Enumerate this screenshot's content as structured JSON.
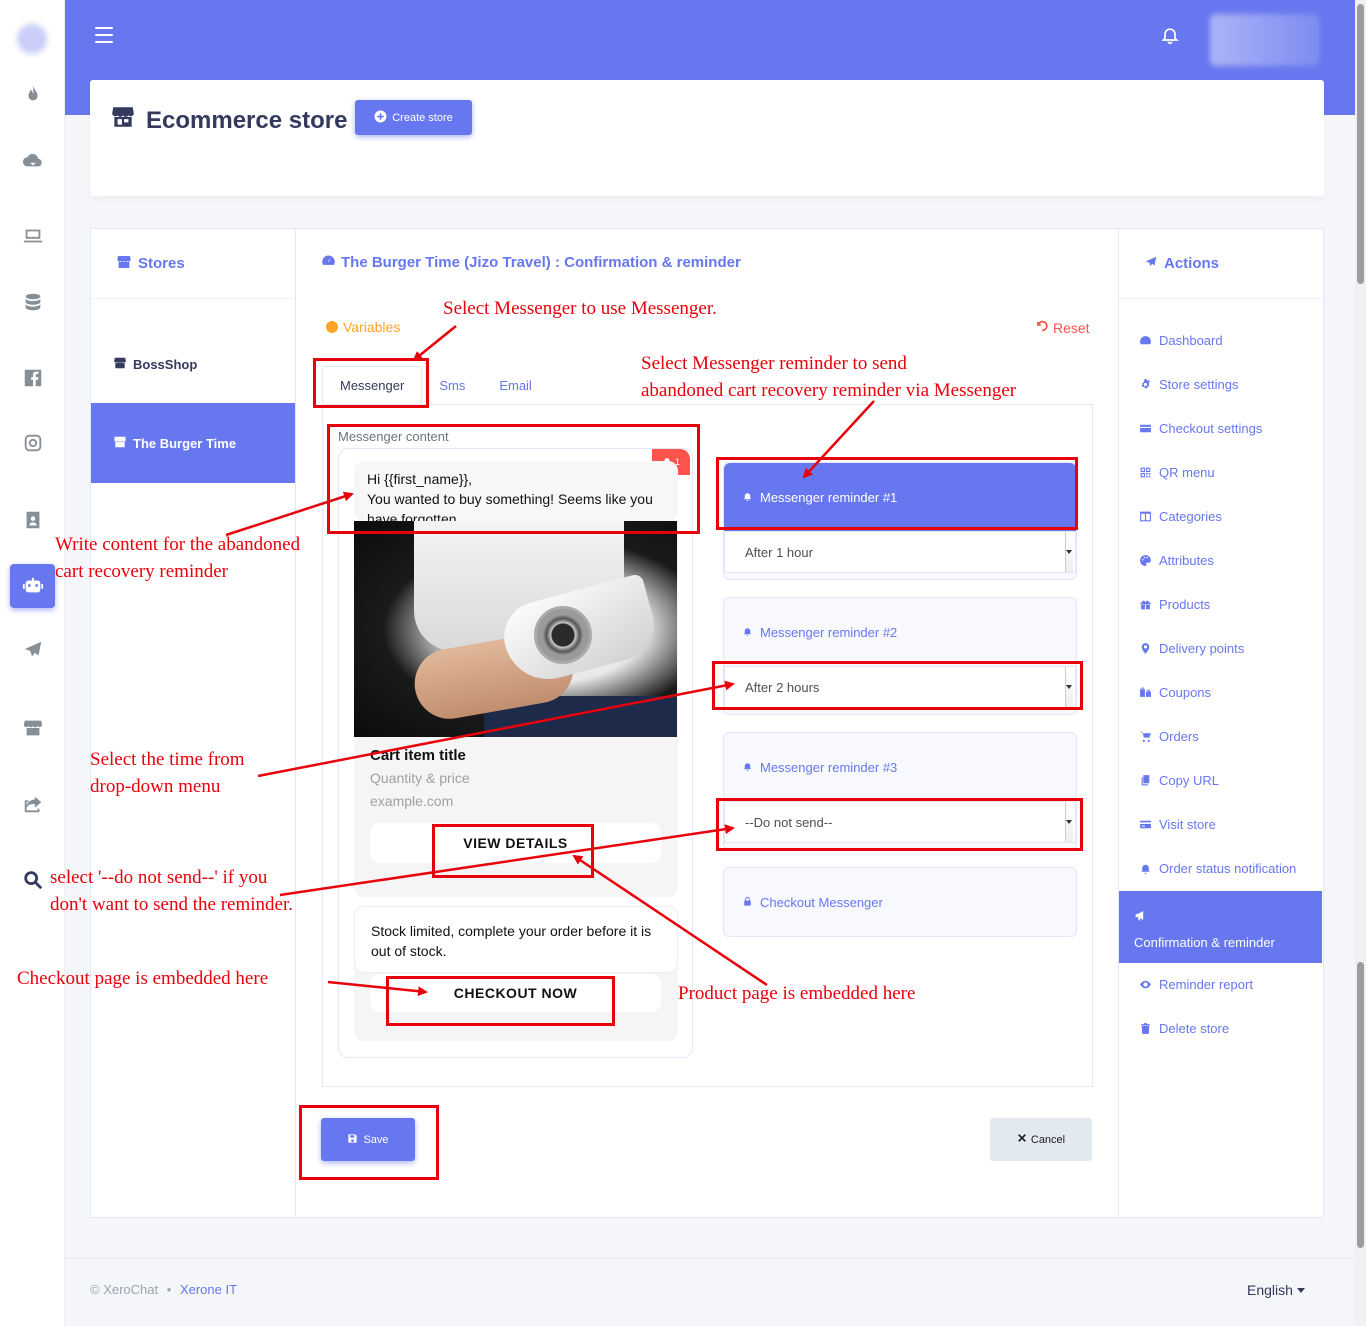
{
  "header": {
    "title": "Ecommerce store",
    "create_label": "Create store"
  },
  "stores": {
    "heading": "Stores",
    "items": [
      {
        "label": "BossShop",
        "active": false
      },
      {
        "label": "The Burger Time",
        "active": true
      }
    ]
  },
  "main": {
    "heading": "The Burger Time (Jizo Travel) : Confirmation & reminder",
    "variables_label": "Variables",
    "reset_label": "Reset",
    "tabs": [
      "Messenger",
      "Sms",
      "Email"
    ],
    "content_label": "Messenger content",
    "badge_count": "1",
    "message_line1": "Hi {{first_name}},",
    "message_line2": "You wanted to buy something! Seems like you",
    "message_line3": "have forgotten",
    "product_title": "Cart item title",
    "product_subtitle": "Quantity & price",
    "product_url": "example.com",
    "product_button": "VIEW DETAILS",
    "checkout_text": "Stock limited, complete your order before it is out of stock.",
    "checkout_button": "CHECKOUT NOW",
    "save_label": "Save",
    "cancel_label": "Cancel"
  },
  "reminders": [
    {
      "label": "Messenger reminder #1",
      "value": "After 1 hour",
      "active": true
    },
    {
      "label": "Messenger reminder #2",
      "value": "After 2 hours",
      "active": false
    },
    {
      "label": "Messenger reminder #3",
      "value": "--Do not send--",
      "active": false
    },
    {
      "label": "Checkout Messenger"
    }
  ],
  "actions": {
    "heading": "Actions",
    "items": [
      {
        "label": "Dashboard",
        "icon": "dashboard-icon"
      },
      {
        "label": "Store settings",
        "icon": "gear-icon"
      },
      {
        "label": "Checkout settings",
        "icon": "card-icon"
      },
      {
        "label": "QR menu",
        "icon": "qrcode-icon"
      },
      {
        "label": "Categories",
        "icon": "columns-icon"
      },
      {
        "label": "Attributes",
        "icon": "palette-icon"
      },
      {
        "label": "Products",
        "icon": "gift-icon"
      },
      {
        "label": "Delivery points",
        "icon": "map-marker-icon"
      },
      {
        "label": "Coupons",
        "icon": "coupon-icon"
      },
      {
        "label": "Orders",
        "icon": "cart-icon"
      },
      {
        "label": "Copy URL",
        "icon": "copy-icon"
      },
      {
        "label": "Visit store",
        "icon": "credit-card-icon"
      },
      {
        "label": "Order status notification",
        "icon": "bell-icon"
      },
      {
        "label": "Confirmation & reminder",
        "icon": "bullhorn-icon",
        "active": true
      },
      {
        "label": "Reminder report",
        "icon": "eye-icon"
      },
      {
        "label": "Delete store",
        "icon": "trash-icon"
      }
    ]
  },
  "footer": {
    "copyright": "© XeroChat",
    "separator": "•",
    "brand": "Xerone IT",
    "language": "English"
  },
  "annotations": {
    "select_messenger": "Select Messenger to use Messenger.",
    "select_reminder_1": "Select Messenger reminder to send",
    "select_reminder_2": "abandoned cart recovery reminder via Messenger",
    "write_content_1": "Write content for the abandoned",
    "write_content_2": "cart recovery reminder",
    "select_time_1": "Select the time from",
    "select_time_2": "drop-down menu",
    "do_not_send_1": "select '--do not send--' if you",
    "do_not_send_2": "don't want to send the reminder.",
    "checkout_embedded": "Checkout page is embedded here",
    "product_embedded": "Product page is embedded here"
  },
  "colors": {
    "primary": "#6777ef",
    "annotation": "#e8000b",
    "warning": "#ffa426",
    "danger": "#fc544b"
  }
}
